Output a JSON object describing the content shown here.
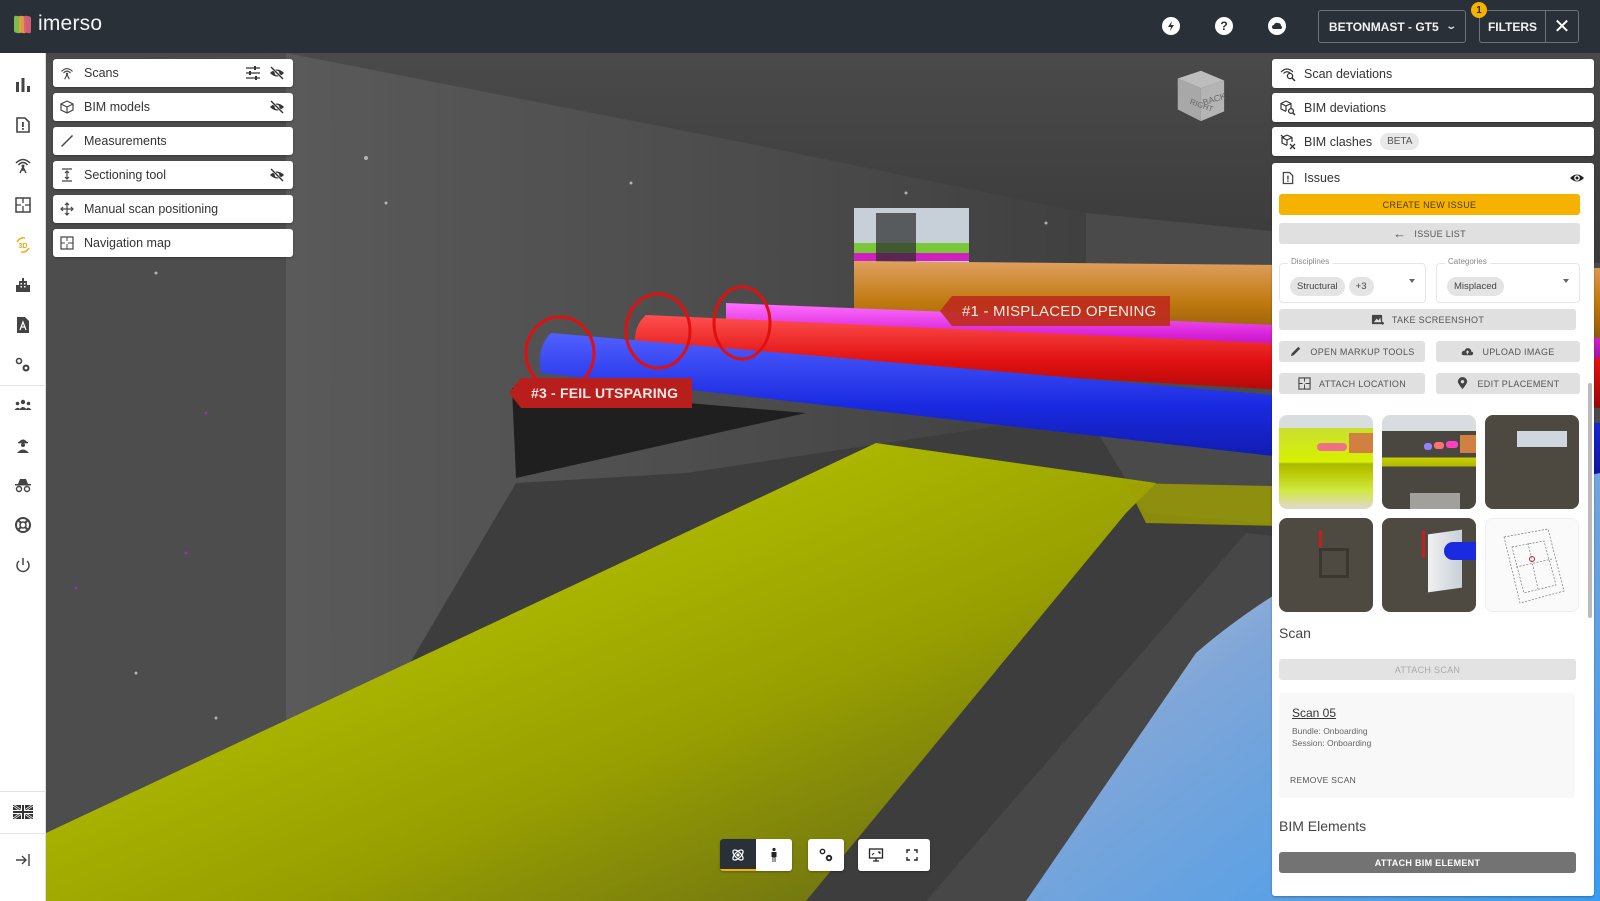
{
  "app": {
    "name": "imerso"
  },
  "header": {
    "icons": [
      "lightning-icon",
      "help-icon",
      "cloud-icon"
    ],
    "project_select": "BETONMAST - GT5",
    "filters_label": "FILTERS",
    "filters_badge": "1",
    "colors": {
      "bar": "#293038",
      "accent": "#f5b200"
    }
  },
  "leftnav": {
    "items": [
      {
        "name": "dashboard",
        "icon": "bar-chart-icon"
      },
      {
        "name": "issues",
        "icon": "issue-file-icon"
      },
      {
        "name": "scans",
        "icon": "scanner-icon"
      },
      {
        "name": "floor-plans",
        "icon": "floor-plan-icon"
      },
      {
        "name": "3d-viewer",
        "icon": "3d-rotate-icon",
        "active": true
      },
      {
        "name": "buildings",
        "icon": "building-icon"
      },
      {
        "name": "drawings",
        "icon": "drawing-file-icon"
      },
      {
        "name": "settings",
        "icon": "gears-icon"
      },
      {
        "name": "users",
        "icon": "people-icon"
      },
      {
        "name": "workers",
        "icon": "worker-icon"
      },
      {
        "name": "incognito",
        "icon": "incognito-icon"
      },
      {
        "name": "support",
        "icon": "lifebuoy-icon"
      },
      {
        "name": "logout",
        "icon": "power-icon"
      }
    ],
    "language_icon": "uk-flag-icon",
    "collapse_icon": "collapse-right-icon"
  },
  "layers": {
    "items": [
      {
        "label": "Scans",
        "icon": "scanner-icon",
        "actions": [
          "sliders-icon",
          "eye-off-icon"
        ]
      },
      {
        "label": "BIM models",
        "icon": "cube-icon",
        "actions": [
          "eye-off-icon"
        ]
      },
      {
        "label": "Measurements",
        "icon": "ruler-icon",
        "actions": []
      },
      {
        "label": "Sectioning tool",
        "icon": "section-icon",
        "actions": [
          "eye-off-icon"
        ]
      },
      {
        "label": "Manual scan positioning",
        "icon": "move-icon",
        "actions": []
      },
      {
        "label": "Navigation map",
        "icon": "map-icon",
        "actions": []
      }
    ]
  },
  "viewcube": {
    "faces": [
      "RIGHT",
      "BACK"
    ]
  },
  "annotations": [
    {
      "label": "#1 - MISPLACED OPENING"
    },
    {
      "label": "#3 - FEIL UTSPARING"
    }
  ],
  "right_panel": {
    "items": [
      {
        "label": "Scan deviations",
        "icon": "scan-search-icon"
      },
      {
        "label": "BIM deviations",
        "icon": "bim-search-icon"
      },
      {
        "label": "BIM clashes",
        "icon": "bim-clash-icon",
        "badge": "BETA"
      }
    ],
    "issues": {
      "title": "Issues",
      "create_label": "CREATE NEW ISSUE",
      "list_label": "ISSUE LIST",
      "disciplines": {
        "label": "Disciplines",
        "chips": [
          "Structural",
          "+3"
        ]
      },
      "categories": {
        "label": "Categories",
        "chips": [
          "Misplaced"
        ]
      },
      "take_screenshot": "TAKE SCREENSHOT",
      "open_markup": "OPEN MARKUP TOOLS",
      "upload_image": "UPLOAD IMAGE",
      "attach_location": "ATTACH LOCATION",
      "edit_placement": "EDIT PLACEMENT",
      "thumbnails": [
        {
          "name": "thumb-bim-overlay-yellow"
        },
        {
          "name": "thumb-bim-overlay-pipes"
        },
        {
          "name": "thumb-wall-opening"
        },
        {
          "name": "thumb-wall-markup"
        },
        {
          "name": "thumb-pipe-penetration"
        },
        {
          "name": "thumb-floor-plan"
        }
      ],
      "scan_section": {
        "title": "Scan",
        "attach_label": "ATTACH SCAN",
        "scan_name": "Scan 05",
        "bundle": "Bundle: Onboarding",
        "session": "Session: Onboarding",
        "remove_label": "REMOVE SCAN"
      },
      "bim_section": {
        "title": "BIM Elements",
        "attach_label": "ATTACH BIM ELEMENT"
      }
    }
  },
  "bottom_toolbar": {
    "groups": [
      [
        {
          "icon": "orbit-icon",
          "active": true
        },
        {
          "icon": "walk-icon",
          "active": false
        }
      ],
      [
        {
          "icon": "settings-icon",
          "active": false
        }
      ],
      [
        {
          "icon": "screen-icon",
          "active": false
        },
        {
          "icon": "fullscreen-icon",
          "active": false
        }
      ]
    ]
  }
}
